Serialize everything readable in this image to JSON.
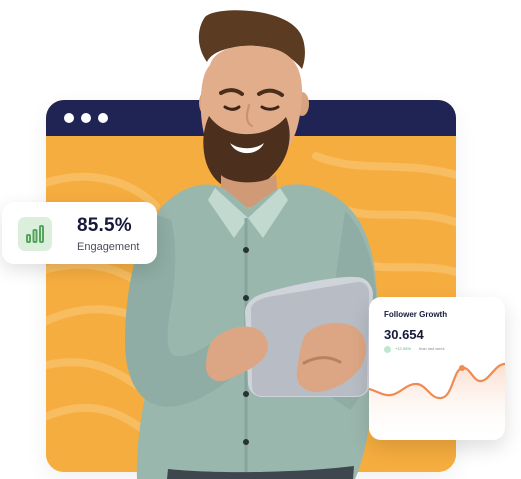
{
  "engagement": {
    "value": "85.5%",
    "label": "Engagement",
    "icon": "bar-chart-icon"
  },
  "follower_growth": {
    "title": "Follower Growth",
    "value": "30.654",
    "change": "+12.09%",
    "period": "than last week"
  },
  "colors": {
    "window_header": "#1f2454",
    "window_body": "#f6ad3f",
    "accent_green": "#58b081",
    "chart_line": "#f08b53"
  }
}
